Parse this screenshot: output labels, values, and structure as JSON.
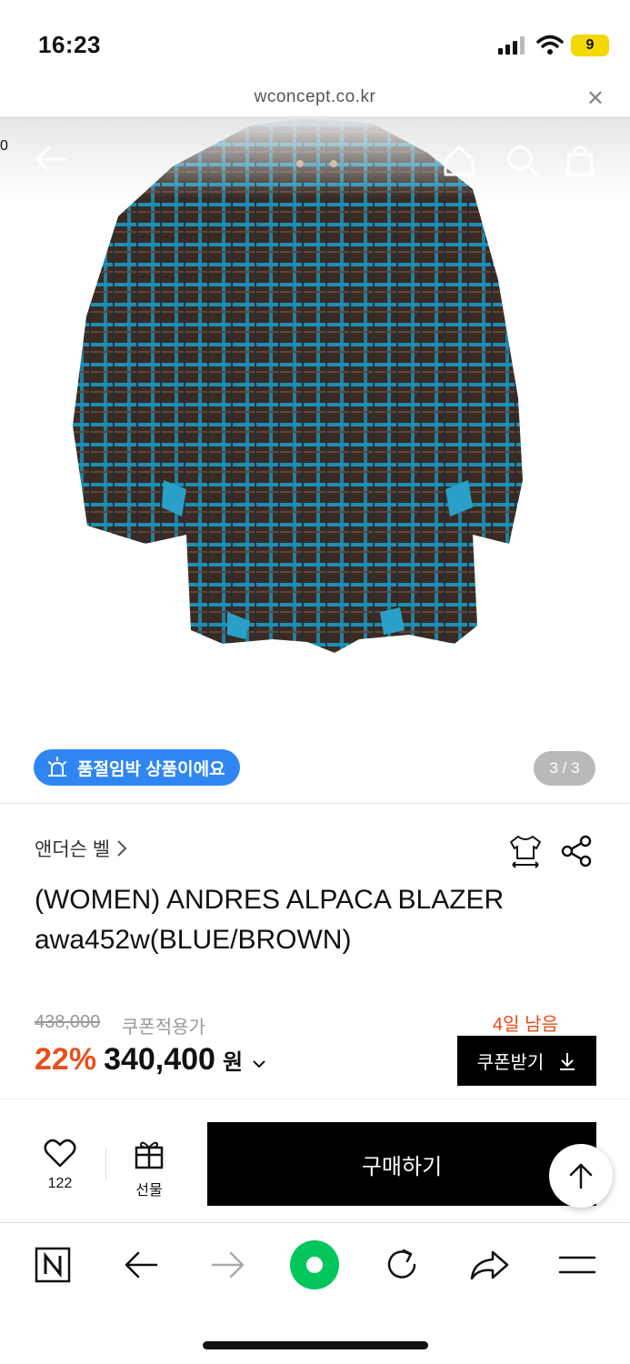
{
  "status_bar": {
    "time": "16:23",
    "battery": "9"
  },
  "browser": {
    "url": "wconcept.co.kr",
    "close_icon": "close-icon"
  },
  "product_header": {
    "cart_count": "0"
  },
  "hero": {
    "badge_text": "품절임박 상품이에요",
    "pager": "3 / 3",
    "jacket_colors": {
      "base": "#3a2a22",
      "check": "#1b8fb6",
      "lining": "#2aa0c8"
    }
  },
  "product": {
    "brand": "앤더슨 벨",
    "title_line1": "(WOMEN) ANDRES ALPACA BLAZER",
    "title_line2": "awa452w(BLUE/BROWN)"
  },
  "pricing": {
    "original_price": "438,000",
    "coupon_note": "쿠폰적용가",
    "days_left": "4일 남음",
    "discount": "22%",
    "price": "340,400",
    "currency": "원",
    "coupon_button": "쿠폰받기"
  },
  "actions": {
    "like_count": "122",
    "gift_label": "선물",
    "buy_label": "구매하기"
  },
  "colors": {
    "accent_blue": "#2f86f3",
    "discount_orange": "#e6501f",
    "naver_green": "#03c75a"
  }
}
